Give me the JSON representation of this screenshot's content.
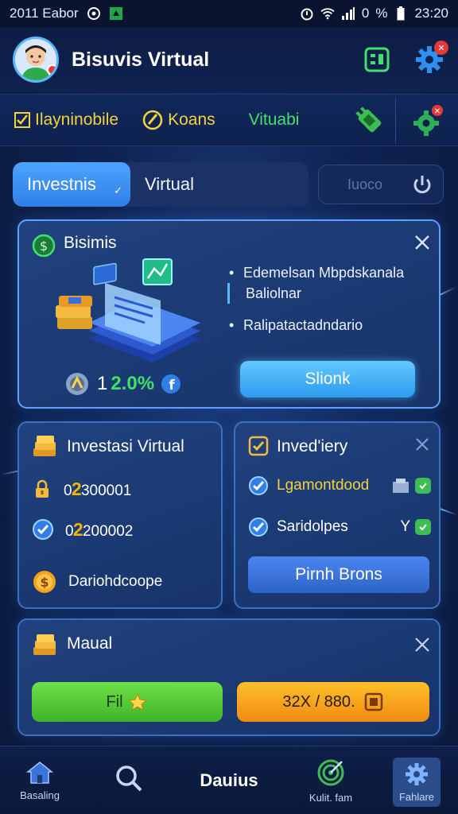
{
  "status_bar": {
    "time_left": "2011 Eabor",
    "battery": "%",
    "battery_prefix": "0",
    "time_right": "23:20"
  },
  "header": {
    "title": "Bisuvis Virtual"
  },
  "categories": [
    {
      "label": "Ilayninobile",
      "color": "#f3d23a"
    },
    {
      "label": "Koans",
      "color": "#f3d23a"
    },
    {
      "label": "Vituabi",
      "color": "#3ee26a"
    }
  ],
  "tabs": [
    {
      "label": "Investnis",
      "active": true
    },
    {
      "label": "Virtual",
      "active": false
    }
  ],
  "pill_button": {
    "label": "Iuoco"
  },
  "business_card": {
    "title": "Bisimis",
    "bullets": [
      "Edemelsan Mbpdskanala",
      "Baliolnar",
      "Ralipatactadndario"
    ],
    "stat_number": "1",
    "stat_percent": "2.0%",
    "cta": "Slionk"
  },
  "invest_card": {
    "title": "Investasi Virtual",
    "rows": [
      {
        "prefix": "0",
        "mid": "2",
        "value": "300001"
      },
      {
        "prefix": "0",
        "mid": "2",
        "value": "200002"
      }
    ],
    "footer": "Dariohdcoope"
  },
  "inventory_card": {
    "title": "Inved'iery",
    "items": [
      {
        "label": "Lgamontdood",
        "tail": ""
      },
      {
        "label": "Saridolpes",
        "tail": "Y"
      }
    ],
    "button": "Pirnh Brons"
  },
  "manual_card": {
    "title": "Maual",
    "green_button": "Fil",
    "orange_button": "32X / 880."
  },
  "bottom_nav": [
    {
      "label": "Basaling"
    },
    {
      "label": ""
    },
    {
      "label": "Dauius"
    },
    {
      "label": "Kulit. fam"
    },
    {
      "label": "Fahlare"
    }
  ],
  "colors": {
    "accent_blue": "#4ea3ff",
    "green": "#3ee26a",
    "yellow": "#f3d23a",
    "orange": "#f08a12",
    "background": "#0f2352"
  }
}
